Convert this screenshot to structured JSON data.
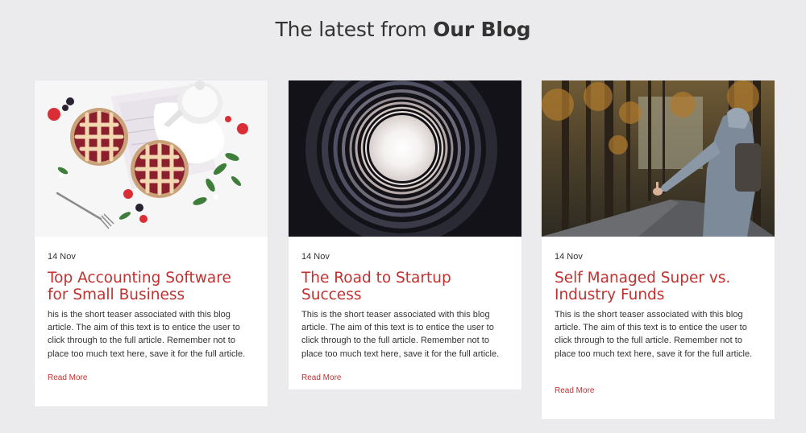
{
  "section": {
    "title_prefix": "The latest from ",
    "title_strong": "Our Blog"
  },
  "posts": [
    {
      "date": "14 Nov",
      "title": "Top Accounting Software for Small Business",
      "teaser": "his is the short teaser associated with this blog article. The aim of this text is to entice the user to click through to the full article. Remember not to place too much text here, save it for the full article.",
      "read_more": "Read More"
    },
    {
      "date": "14 Nov",
      "title": "The Road to Startup Success",
      "teaser": "This is the short teaser associated with this blog article. The aim of this text is to entice the user to click through to the full article. Remember not to place too much text here, save it for the full article.",
      "read_more": "Read More"
    },
    {
      "date": "14 Nov",
      "title": "Self Managed Super vs. Industry Funds",
      "teaser": "This is the short teaser associated with this blog article. The aim of this text is to entice the user to click through to the full article. Remember not to place too much text here, save it for the full article.",
      "read_more": "Read More"
    }
  ],
  "colors": {
    "background": "#ebebed",
    "accent": "#c0312f",
    "text": "#333333",
    "card": "#ffffff"
  }
}
